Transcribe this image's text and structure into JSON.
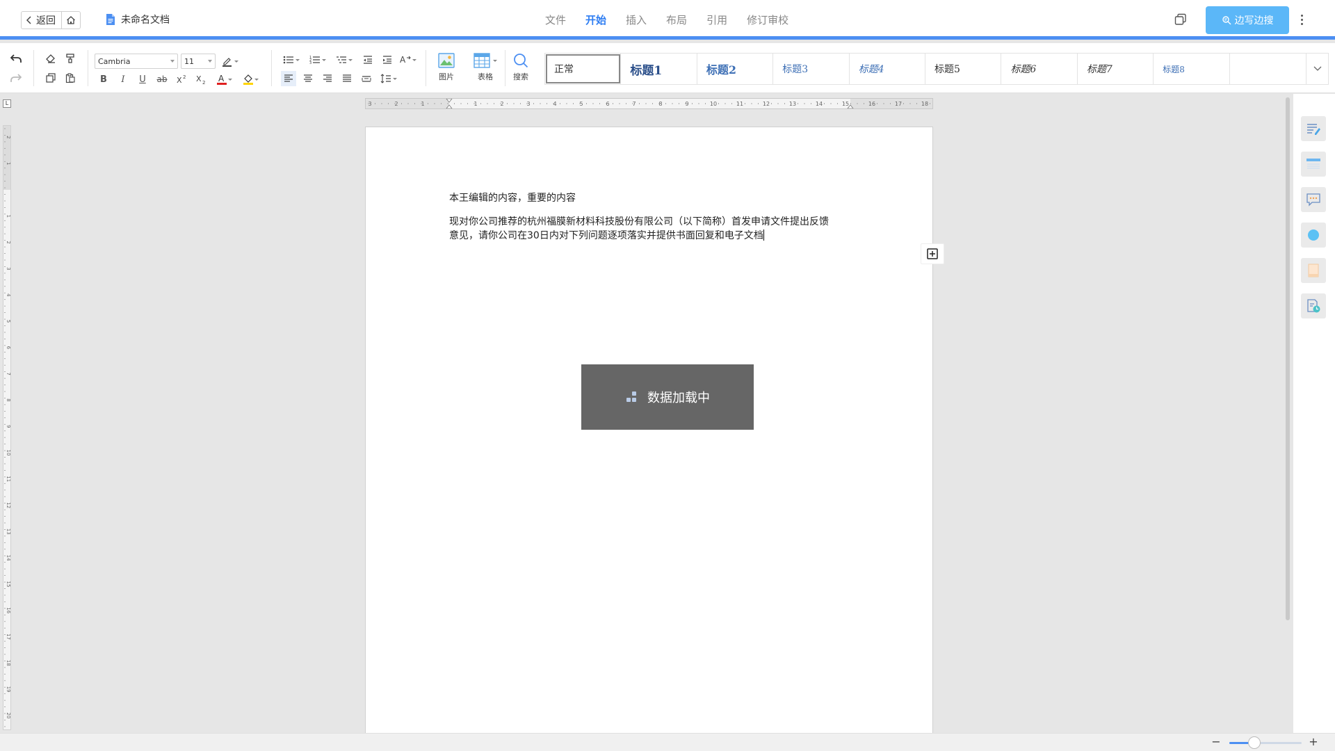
{
  "header": {
    "back_label": "返回",
    "doc_title": "未命名文档",
    "tabs": [
      {
        "label": "文件",
        "active": false
      },
      {
        "label": "开始",
        "active": true
      },
      {
        "label": "插入",
        "active": false
      },
      {
        "label": "布局",
        "active": false
      },
      {
        "label": "引用",
        "active": false
      },
      {
        "label": "修订审校",
        "active": false
      }
    ],
    "write_button": "边写边搜"
  },
  "toolbar": {
    "font_family": "Cambria",
    "font_size": "11",
    "bold": "B",
    "italic": "I",
    "underline": "U",
    "strikethrough": "ab",
    "image_label": "图片",
    "table_label": "表格",
    "search_label": "搜索",
    "accent_color": "#4c8ff2",
    "font_color": "#e02020",
    "highlight_color": "#ffd400"
  },
  "styles": [
    "正常",
    "标题1",
    "标题2",
    "标题3",
    "标题4",
    "标题5",
    "标题6",
    "标题7",
    "标题8"
  ],
  "document": {
    "line1": "本王编辑的内容，重要的内容",
    "line2": "现对你公司推荐的杭州福膜新材料科技股份有限公司（以下简称）首发申请文件提出反馈",
    "line3": "意见，请你公司在30日内对下列问题逐项落实并提供书面回复和电子文档"
  },
  "ruler": {
    "corner": "L",
    "h_left_ticks": [
      "3",
      "2",
      "1"
    ],
    "h_ticks": [
      "1",
      "2",
      "3",
      "4",
      "5",
      "6",
      "7",
      "8",
      "9",
      "10",
      "11",
      "12",
      "13",
      "14",
      "15",
      "16",
      "17",
      "18"
    ],
    "v_ticks": [
      "2",
      "1",
      "1",
      "2",
      "3",
      "4",
      "5",
      "6",
      "7",
      "8",
      "9",
      "10",
      "11",
      "12",
      "13",
      "14",
      "15",
      "16",
      "17",
      "18",
      "19",
      "20"
    ]
  },
  "loading": {
    "text": "数据加载中"
  },
  "zoom": {
    "minus": "−",
    "plus": "+",
    "level": 0.35
  }
}
